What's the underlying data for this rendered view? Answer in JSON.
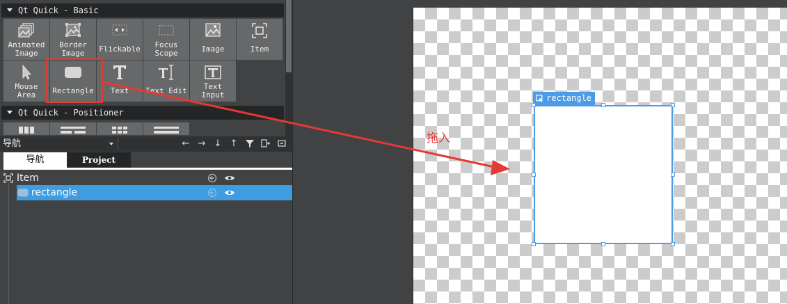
{
  "library": {
    "section_basic": "Qt Quick - Basic",
    "section_positioner": "Qt Quick - Positioner",
    "basic_items": [
      {
        "label": "Animated\nImage",
        "icon": "animated-image-icon"
      },
      {
        "label": "Border\nImage",
        "icon": "border-image-icon"
      },
      {
        "label": "Flickable",
        "icon": "flickable-icon"
      },
      {
        "label": "Focus\nScope",
        "icon": "focus-scope-icon"
      },
      {
        "label": "Image",
        "icon": "image-icon"
      },
      {
        "label": "Item",
        "icon": "item-icon"
      },
      {
        "label": "Mouse\nArea",
        "icon": "mouse-area-icon"
      },
      {
        "label": "Rectangle",
        "icon": "rectangle-icon"
      },
      {
        "label": "Text",
        "icon": "text-icon"
      },
      {
        "label": "Text Edit",
        "icon": "text-edit-icon"
      },
      {
        "label": "Text\nInput",
        "icon": "text-input-icon"
      }
    ]
  },
  "navigator": {
    "combo_label": "导航",
    "tabs": [
      "导航",
      "Project"
    ],
    "tree": [
      {
        "label": "Item"
      },
      {
        "label": "rectangle"
      }
    ]
  },
  "canvas": {
    "selected_tag": "rectangle"
  },
  "annotation": {
    "drag_label": "拖入",
    "color": "#e53935"
  },
  "colors": {
    "selection": "#4a9be8",
    "tree_highlight": "#3d9de0"
  }
}
